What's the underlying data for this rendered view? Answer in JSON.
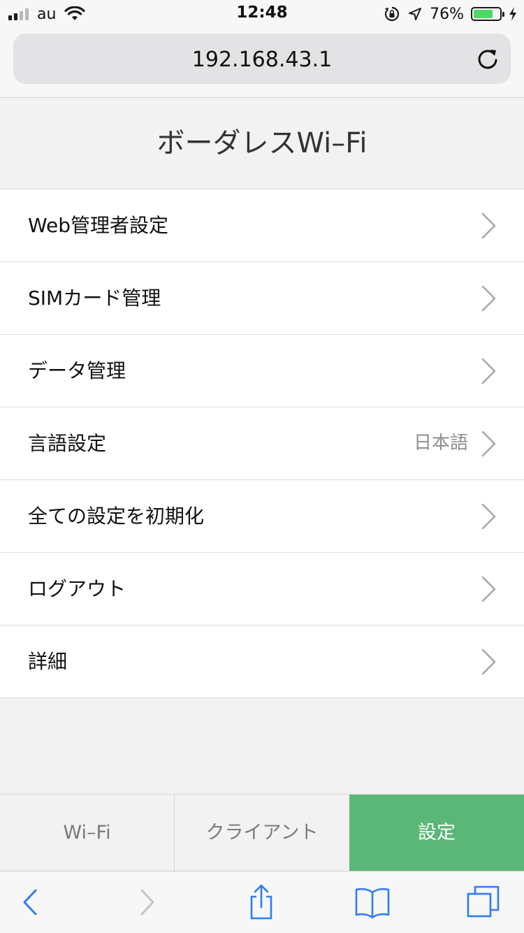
{
  "status_bar": {
    "carrier": "au",
    "time": "12:48",
    "battery_percent": "76%",
    "battery_level": 0.76,
    "signal_bars_filled": 2,
    "signal_bars_total": 4,
    "icons": [
      "wifi-icon",
      "orientation-lock-icon",
      "location-arrow-icon",
      "battery-icon",
      "charging-bolt-icon"
    ]
  },
  "url_bar": {
    "url": "192.168.43.1",
    "reload_icon": "reload-icon"
  },
  "page": {
    "title": "ボーダレスWi–Fi",
    "menu": [
      {
        "label": "Web管理者設定",
        "value": ""
      },
      {
        "label": "SIMカード管理",
        "value": ""
      },
      {
        "label": "データ管理",
        "value": ""
      },
      {
        "label": "言語設定",
        "value": "日本語"
      },
      {
        "label": "全ての設定を初期化",
        "value": ""
      },
      {
        "label": "ログアウト",
        "value": ""
      },
      {
        "label": "詳細",
        "value": ""
      }
    ]
  },
  "tabs": [
    {
      "label": "Wi–Fi",
      "active": false
    },
    {
      "label": "クライアント",
      "active": false
    },
    {
      "label": "設定",
      "active": true
    }
  ],
  "colors": {
    "accent_green": "#5bb777",
    "ios_blue": "#2f7cf6",
    "battery_green": "#4cd964"
  },
  "toolbar": {
    "icons": [
      "back-icon",
      "forward-icon",
      "share-icon",
      "bookmarks-icon",
      "tabs-icon"
    ]
  }
}
